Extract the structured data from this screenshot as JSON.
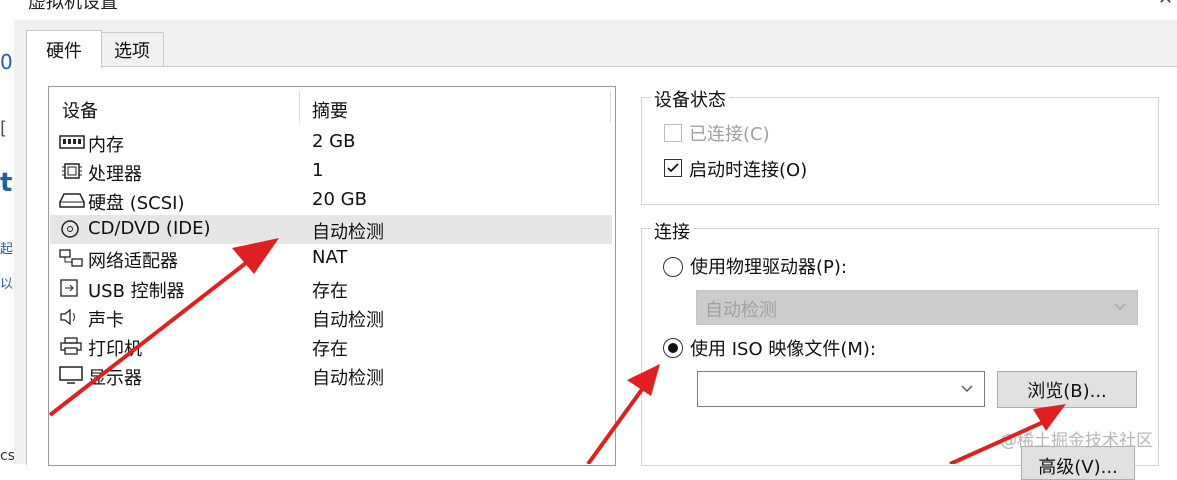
{
  "window": {
    "title": "虚拟机设置",
    "close_glyph": "✕"
  },
  "background_window": {
    "fragments": [
      "0",
      "[",
      "t",
      "起",
      "以",
      "cs"
    ]
  },
  "tabs": [
    {
      "label": "硬件",
      "active": true
    },
    {
      "label": "选项",
      "active": false
    }
  ],
  "devices": {
    "header_device": "设备",
    "header_summary": "摘要",
    "rows": [
      {
        "icon": "memory-icon",
        "name": "内存",
        "summary": "2 GB",
        "selected": false
      },
      {
        "icon": "processor-icon",
        "name": "处理器",
        "summary": "1",
        "selected": false
      },
      {
        "icon": "hard-disk-icon",
        "name": "硬盘 (SCSI)",
        "summary": "20 GB",
        "selected": false
      },
      {
        "icon": "cd-dvd-icon",
        "name": "CD/DVD (IDE)",
        "summary": "自动检测",
        "selected": true
      },
      {
        "icon": "network-adapter-icon",
        "name": "网络适配器",
        "summary": "NAT",
        "selected": false
      },
      {
        "icon": "usb-icon",
        "name": "USB 控制器",
        "summary": "存在",
        "selected": false
      },
      {
        "icon": "sound-card-icon",
        "name": "声卡",
        "summary": "自动检测",
        "selected": false
      },
      {
        "icon": "printer-icon",
        "name": "打印机",
        "summary": "存在",
        "selected": false
      },
      {
        "icon": "display-icon",
        "name": "显示器",
        "summary": "自动检测",
        "selected": false
      }
    ]
  },
  "device_status": {
    "legend": "设备状态",
    "connected_label": "已连接(C)",
    "connected_checked": false,
    "connected_enabled": false,
    "connect_at_power_on_label": "启动时连接(O)",
    "connect_at_power_on_checked": true
  },
  "connection": {
    "legend": "连接",
    "physical_drive_label": "使用物理驱动器(P):",
    "physical_drive_selected": false,
    "physical_drive_value": "自动检测",
    "iso_label": "使用 ISO 映像文件(M):",
    "iso_selected": true,
    "iso_value": "",
    "browse_label": "浏览(B)...",
    "advanced_label": "高级(V)..."
  },
  "watermark": "@稀土掘金技术社区",
  "colors": {
    "dialog_bg": "#f0f0f0",
    "selected_row": "#e6e6e6",
    "arrow": "#e02020"
  }
}
